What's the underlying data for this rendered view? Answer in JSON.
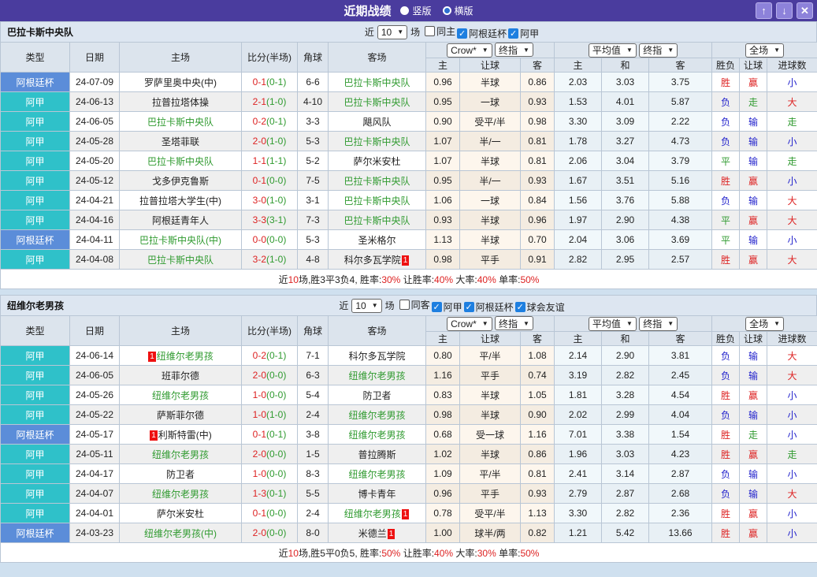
{
  "titlebar": {
    "title": "近期战绩",
    "radios": [
      {
        "label": "竖版",
        "selected": true
      },
      {
        "label": "横版",
        "selected": false
      }
    ],
    "buttons": {
      "up": "↑",
      "down": "↓",
      "close": "✕"
    }
  },
  "columns": {
    "type": "类型",
    "date": "日期",
    "home": "主场",
    "score": "比分(半场)",
    "corner": "角球",
    "away": "客场",
    "h": "主",
    "handicap": "让球",
    "a": "客",
    "avg_h": "主",
    "avg_d": "和",
    "avg_a": "客",
    "result": "胜负",
    "hresult": "让球",
    "goals": "进球数"
  },
  "type_colors": {
    "阿根廷杯": "#5b8dd9",
    "阿甲": "#2fc1c9"
  },
  "result_colors": {
    "胜": "#dd2222",
    "赢": "#dd2222",
    "大": "#dd2222",
    "负": "#2222cc",
    "输": "#2222cc",
    "小": "#2222cc",
    "平": "#2f9a2f",
    "走": "#2f9a2f"
  },
  "colors": {
    "titlebar_bg": "#4a3c9e",
    "window_button": "#8d82da",
    "cup_badge": "#5b8dd9",
    "league_badge": "#2fc1c9",
    "team_green": "#2f9a2f",
    "score_red": "#dd2222",
    "half_green": "#2f9a2f",
    "lose_blue": "#2222cc",
    "red_card_badge": "#ee1111",
    "checkbox_on": "#1e7fe0"
  },
  "tables": [
    {
      "team": "巴拉卡斯中央队",
      "filter": {
        "prefix": "近",
        "count": "10",
        "suffix": "场",
        "checks": [
          {
            "label": "同主",
            "on": false
          },
          {
            "label": "阿根廷杯",
            "on": true
          },
          {
            "label": "阿甲",
            "on": true
          }
        ]
      },
      "selects": {
        "book": "Crow*",
        "book_time": "终指",
        "avg": "平均值",
        "avg_time": "终指",
        "scope": "全场"
      },
      "rows": [
        {
          "type": "阿根廷杯",
          "date": "24-07-09",
          "home": {
            "n": "罗萨里奥中央(中)"
          },
          "score": "0-1",
          "half": "(0-1)",
          "corner": "6-6",
          "away": {
            "n": "巴拉卡斯中央队",
            "g": true
          },
          "odds": [
            "0.96",
            "半球",
            "0.86"
          ],
          "avg": [
            "2.03",
            "3.03",
            "3.75"
          ],
          "res": [
            "胜",
            "赢",
            "小"
          ]
        },
        {
          "type": "阿甲",
          "date": "24-06-13",
          "home": {
            "n": "拉普拉塔体操"
          },
          "score": "2-1",
          "half": "(1-0)",
          "corner": "4-10",
          "away": {
            "n": "巴拉卡斯中央队",
            "g": true
          },
          "odds": [
            "0.95",
            "一球",
            "0.93"
          ],
          "avg": [
            "1.53",
            "4.01",
            "5.87"
          ],
          "res": [
            "负",
            "走",
            "大"
          ]
        },
        {
          "type": "阿甲",
          "date": "24-06-05",
          "home": {
            "n": "巴拉卡斯中央队",
            "g": true
          },
          "score": "0-2",
          "half": "(0-1)",
          "corner": "3-3",
          "away": {
            "n": "飓风队"
          },
          "odds": [
            "0.90",
            "受平/半",
            "0.98"
          ],
          "avg": [
            "3.30",
            "3.09",
            "2.22"
          ],
          "res": [
            "负",
            "输",
            "走"
          ]
        },
        {
          "type": "阿甲",
          "date": "24-05-28",
          "home": {
            "n": "圣塔菲联"
          },
          "score": "2-0",
          "half": "(1-0)",
          "corner": "5-3",
          "away": {
            "n": "巴拉卡斯中央队",
            "g": true
          },
          "odds": [
            "1.07",
            "半/一",
            "0.81"
          ],
          "avg": [
            "1.78",
            "3.27",
            "4.73"
          ],
          "res": [
            "负",
            "输",
            "小"
          ]
        },
        {
          "type": "阿甲",
          "date": "24-05-20",
          "home": {
            "n": "巴拉卡斯中央队",
            "g": true
          },
          "score": "1-1",
          "half": "(1-1)",
          "corner": "5-2",
          "away": {
            "n": "萨尔米安杜"
          },
          "odds": [
            "1.07",
            "半球",
            "0.81"
          ],
          "avg": [
            "2.06",
            "3.04",
            "3.79"
          ],
          "res": [
            "平",
            "输",
            "走"
          ]
        },
        {
          "type": "阿甲",
          "date": "24-05-12",
          "home": {
            "n": "戈多伊克鲁斯"
          },
          "score": "0-1",
          "half": "(0-0)",
          "corner": "7-5",
          "away": {
            "n": "巴拉卡斯中央队",
            "g": true
          },
          "odds": [
            "0.95",
            "半/一",
            "0.93"
          ],
          "avg": [
            "1.67",
            "3.51",
            "5.16"
          ],
          "res": [
            "胜",
            "赢",
            "小"
          ]
        },
        {
          "type": "阿甲",
          "date": "24-04-21",
          "home": {
            "n": "拉普拉塔大学生(中)"
          },
          "score": "3-0",
          "half": "(1-0)",
          "corner": "3-1",
          "away": {
            "n": "巴拉卡斯中央队",
            "g": true
          },
          "odds": [
            "1.06",
            "一球",
            "0.84"
          ],
          "avg": [
            "1.56",
            "3.76",
            "5.88"
          ],
          "res": [
            "负",
            "输",
            "大"
          ]
        },
        {
          "type": "阿甲",
          "date": "24-04-16",
          "home": {
            "n": "阿根廷青年人"
          },
          "score": "3-3",
          "half": "(3-1)",
          "corner": "7-3",
          "away": {
            "n": "巴拉卡斯中央队",
            "g": true
          },
          "odds": [
            "0.93",
            "半球",
            "0.96"
          ],
          "avg": [
            "1.97",
            "2.90",
            "4.38"
          ],
          "res": [
            "平",
            "赢",
            "大"
          ]
        },
        {
          "type": "阿根廷杯",
          "date": "24-04-11",
          "home": {
            "n": "巴拉卡斯中央队(中)",
            "g": true
          },
          "score": "0-0",
          "half": "(0-0)",
          "corner": "5-3",
          "away": {
            "n": "圣米格尔"
          },
          "odds": [
            "1.13",
            "半球",
            "0.70"
          ],
          "avg": [
            "2.04",
            "3.06",
            "3.69"
          ],
          "res": [
            "平",
            "输",
            "小"
          ]
        },
        {
          "type": "阿甲",
          "date": "24-04-08",
          "home": {
            "n": "巴拉卡斯中央队",
            "g": true
          },
          "score": "3-2",
          "half": "(1-0)",
          "corner": "4-8",
          "away": {
            "n": "科尔多瓦学院",
            "b": "post"
          },
          "odds": [
            "0.98",
            "平手",
            "0.91"
          ],
          "avg": [
            "2.82",
            "2.95",
            "2.57"
          ],
          "res": [
            "胜",
            "赢",
            "大"
          ]
        }
      ],
      "summary": [
        {
          "t": "近"
        },
        {
          "t": "10",
          "r": true
        },
        {
          "t": "场,胜3平3负4, 胜率:"
        },
        {
          "t": "30%",
          "r": true
        },
        {
          "t": " 让胜率:"
        },
        {
          "t": "40%",
          "r": true
        },
        {
          "t": " 大率:"
        },
        {
          "t": "40%",
          "r": true
        },
        {
          "t": " 单率:"
        },
        {
          "t": "50%",
          "r": true
        }
      ]
    },
    {
      "team": "纽维尔老男孩",
      "filter": {
        "prefix": "近",
        "count": "10",
        "suffix": "场",
        "checks": [
          {
            "label": "同客",
            "on": false
          },
          {
            "label": "阿甲",
            "on": true
          },
          {
            "label": "阿根廷杯",
            "on": true
          },
          {
            "label": "球会友谊",
            "on": true
          }
        ]
      },
      "selects": {
        "book": "Crow*",
        "book_time": "终指",
        "avg": "平均值",
        "avg_time": "终指",
        "scope": "全场"
      },
      "rows": [
        {
          "type": "阿甲",
          "date": "24-06-14",
          "home": {
            "n": "纽维尔老男孩",
            "g": true,
            "b": "pre"
          },
          "score": "0-2",
          "half": "(0-1)",
          "corner": "7-1",
          "away": {
            "n": "科尔多瓦学院"
          },
          "odds": [
            "0.80",
            "平/半",
            "1.08"
          ],
          "avg": [
            "2.14",
            "2.90",
            "3.81"
          ],
          "res": [
            "负",
            "输",
            "大"
          ]
        },
        {
          "type": "阿甲",
          "date": "24-06-05",
          "home": {
            "n": "班菲尔德"
          },
          "score": "2-0",
          "half": "(0-0)",
          "corner": "6-3",
          "away": {
            "n": "纽维尔老男孩",
            "g": true
          },
          "odds": [
            "1.16",
            "平手",
            "0.74"
          ],
          "avg": [
            "3.19",
            "2.82",
            "2.45"
          ],
          "res": [
            "负",
            "输",
            "大"
          ]
        },
        {
          "type": "阿甲",
          "date": "24-05-26",
          "home": {
            "n": "纽维尔老男孩",
            "g": true
          },
          "score": "1-0",
          "half": "(0-0)",
          "corner": "5-4",
          "away": {
            "n": "防卫者"
          },
          "odds": [
            "0.83",
            "半球",
            "1.05"
          ],
          "avg": [
            "1.81",
            "3.28",
            "4.54"
          ],
          "res": [
            "胜",
            "赢",
            "小"
          ]
        },
        {
          "type": "阿甲",
          "date": "24-05-22",
          "home": {
            "n": "萨斯菲尔德"
          },
          "score": "1-0",
          "half": "(1-0)",
          "corner": "2-4",
          "away": {
            "n": "纽维尔老男孩",
            "g": true
          },
          "odds": [
            "0.98",
            "半球",
            "0.90"
          ],
          "avg": [
            "2.02",
            "2.99",
            "4.04"
          ],
          "res": [
            "负",
            "输",
            "小"
          ]
        },
        {
          "type": "阿根廷杯",
          "date": "24-05-17",
          "home": {
            "n": "利斯特雷(中)",
            "b": "pre"
          },
          "score": "0-1",
          "half": "(0-1)",
          "corner": "3-8",
          "away": {
            "n": "纽维尔老男孩",
            "g": true
          },
          "odds": [
            "0.68",
            "受一球",
            "1.16"
          ],
          "avg": [
            "7.01",
            "3.38",
            "1.54"
          ],
          "res": [
            "胜",
            "走",
            "小"
          ]
        },
        {
          "type": "阿甲",
          "date": "24-05-11",
          "home": {
            "n": "纽维尔老男孩",
            "g": true
          },
          "score": "2-0",
          "half": "(0-0)",
          "corner": "1-5",
          "away": {
            "n": "普拉腾斯"
          },
          "odds": [
            "1.02",
            "半球",
            "0.86"
          ],
          "avg": [
            "1.96",
            "3.03",
            "4.23"
          ],
          "res": [
            "胜",
            "赢",
            "走"
          ]
        },
        {
          "type": "阿甲",
          "date": "24-04-17",
          "home": {
            "n": "防卫者"
          },
          "score": "1-0",
          "half": "(0-0)",
          "corner": "8-3",
          "away": {
            "n": "纽维尔老男孩",
            "g": true
          },
          "odds": [
            "1.09",
            "平/半",
            "0.81"
          ],
          "avg": [
            "2.41",
            "3.14",
            "2.87"
          ],
          "res": [
            "负",
            "输",
            "小"
          ]
        },
        {
          "type": "阿甲",
          "date": "24-04-07",
          "home": {
            "n": "纽维尔老男孩",
            "g": true
          },
          "score": "1-3",
          "half": "(0-1)",
          "corner": "5-5",
          "away": {
            "n": "博卡青年"
          },
          "odds": [
            "0.96",
            "平手",
            "0.93"
          ],
          "avg": [
            "2.79",
            "2.87",
            "2.68"
          ],
          "res": [
            "负",
            "输",
            "大"
          ]
        },
        {
          "type": "阿甲",
          "date": "24-04-01",
          "home": {
            "n": "萨尔米安杜"
          },
          "score": "0-1",
          "half": "(0-0)",
          "corner": "2-4",
          "away": {
            "n": "纽维尔老男孩",
            "g": true,
            "b": "post"
          },
          "odds": [
            "0.78",
            "受平/半",
            "1.13"
          ],
          "avg": [
            "3.30",
            "2.82",
            "2.36"
          ],
          "res": [
            "胜",
            "赢",
            "小"
          ]
        },
        {
          "type": "阿根廷杯",
          "date": "24-03-23",
          "home": {
            "n": "纽维尔老男孩(中)",
            "g": true
          },
          "score": "2-0",
          "half": "(0-0)",
          "corner": "8-0",
          "away": {
            "n": "米德兰",
            "b": "post"
          },
          "odds": [
            "1.00",
            "球半/两",
            "0.82"
          ],
          "avg": [
            "1.21",
            "5.42",
            "13.66"
          ],
          "res": [
            "胜",
            "赢",
            "小"
          ]
        }
      ],
      "summary": [
        {
          "t": "近"
        },
        {
          "t": "10",
          "r": true
        },
        {
          "t": "场,胜5平0负5, 胜率:"
        },
        {
          "t": "50%",
          "r": true
        },
        {
          "t": " 让胜率:"
        },
        {
          "t": "40%",
          "r": true
        },
        {
          "t": " 大率:"
        },
        {
          "t": "30%",
          "r": true
        },
        {
          "t": " 单率:"
        },
        {
          "t": "50%",
          "r": true
        }
      ]
    }
  ]
}
